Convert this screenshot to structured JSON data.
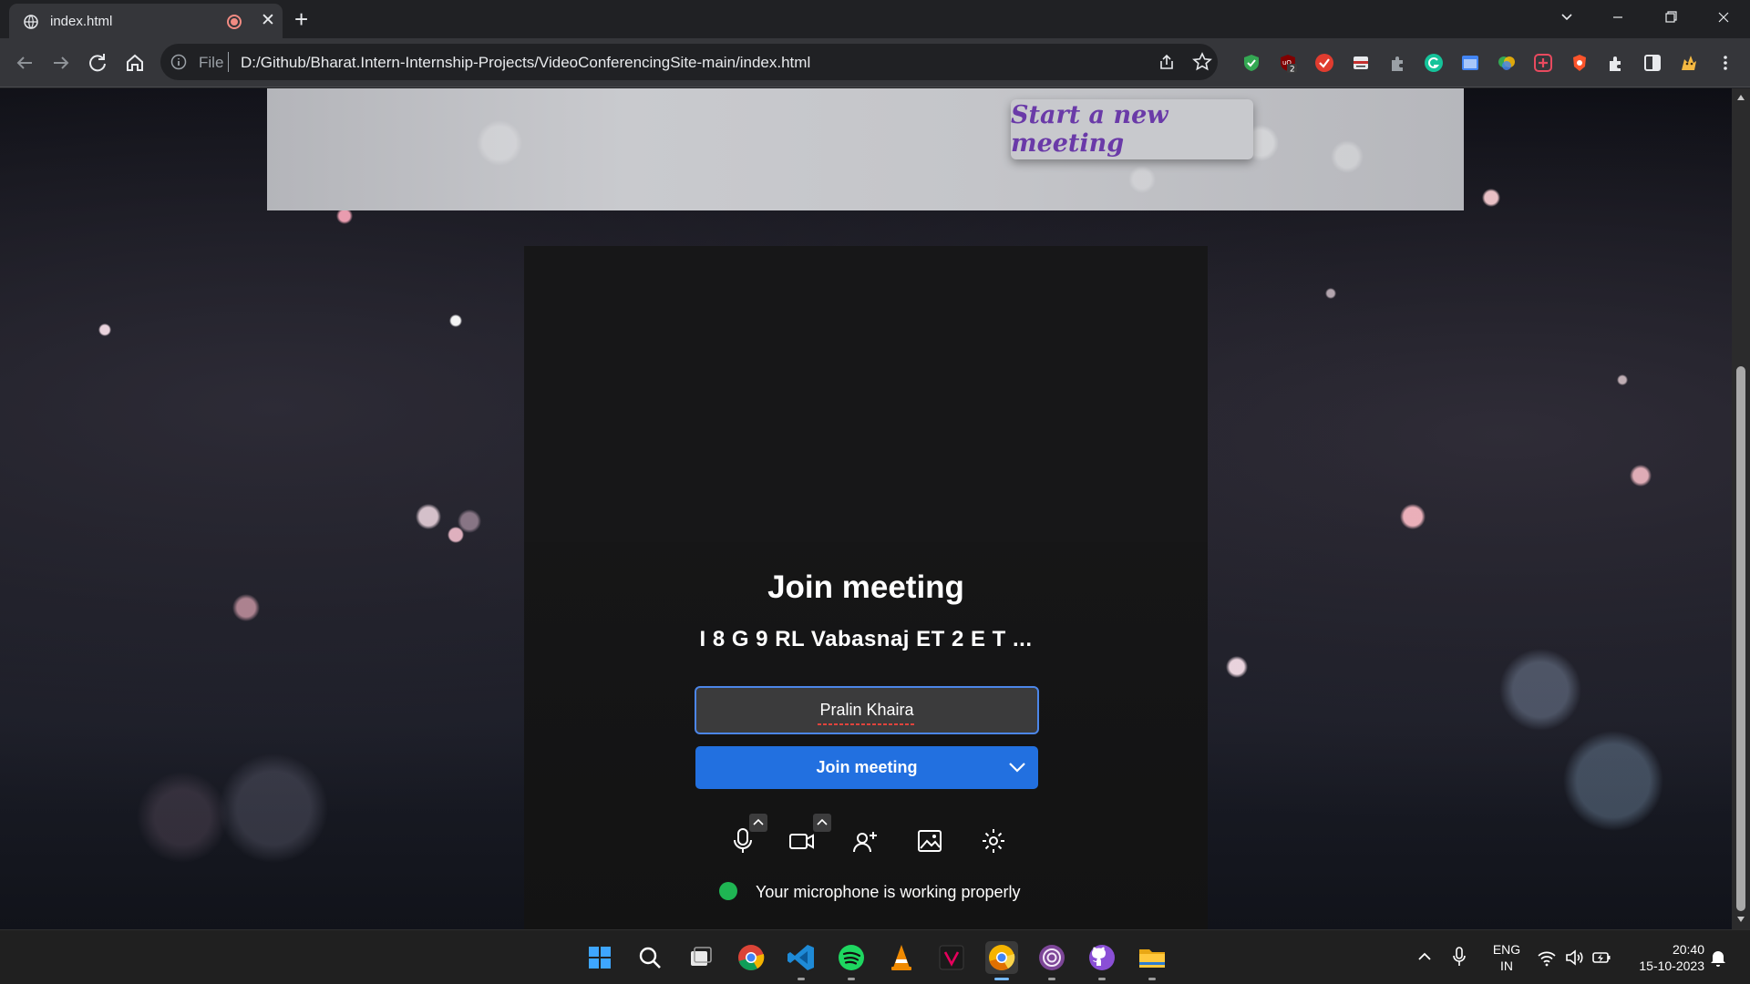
{
  "browser": {
    "tab_title": "index.html",
    "url_scheme": "File",
    "url": "D:/Github/Bharat.Intern-Internship-Projects/VideoConferencingSite-main/index.html",
    "extensions": [
      {
        "name": "shield-extension-icon",
        "color": "#34a853"
      },
      {
        "name": "ublock-extension-icon",
        "color": "#800000",
        "badge": "2"
      },
      {
        "name": "todoist-extension-icon",
        "color": "#e03c2f"
      },
      {
        "name": "reader-extension-icon",
        "color": "#e8eaed"
      },
      {
        "name": "puzzle-gray-extension-icon",
        "color": "#9aa0a6"
      },
      {
        "name": "grammarly-extension-icon",
        "color": "#15c39a"
      },
      {
        "name": "window-extension-icon",
        "color": "#4285f4"
      },
      {
        "name": "color-extension-icon",
        "color": "#fbbc04"
      },
      {
        "name": "plus-extension-icon",
        "color": "#e84a5f"
      },
      {
        "name": "brave-extension-icon",
        "color": "#fb542b"
      },
      {
        "name": "extensions-icon",
        "color": "#e8eaed"
      },
      {
        "name": "sidepanel-icon",
        "color": "#e8eaed"
      },
      {
        "name": "profile-avatar-icon",
        "color": "#f5b942"
      },
      {
        "name": "menu-icon",
        "color": "#e8eaed"
      }
    ]
  },
  "page": {
    "new_meeting_button": "Start a new meeting",
    "join_title": "Join meeting",
    "meeting_code": "I 8 G 9 RL Vabasnaj ET 2 E T ...",
    "name_value": "Pralin Khaira",
    "join_button": "Join meeting",
    "mic_status": "Your microphone is working properly",
    "mic_status_color": "#1fb553",
    "accent_color": "#2270e0"
  },
  "taskbar": {
    "apps": [
      "windows-start-icon",
      "search-icon",
      "task-view-icon",
      "chrome-icon",
      "vscode-icon",
      "spotify-icon",
      "vlc-icon",
      "app-v-icon",
      "chrome-canary-icon",
      "tor-icon",
      "github-desktop-icon",
      "file-explorer-icon"
    ],
    "lang_line1": "ENG",
    "lang_line2": "IN",
    "time": "20:40",
    "date": "15-10-2023"
  }
}
